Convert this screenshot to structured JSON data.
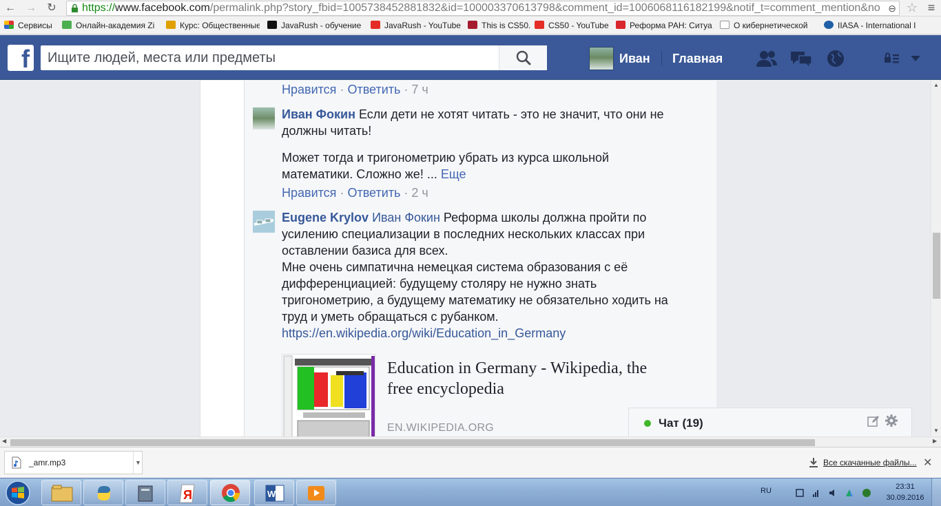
{
  "browser": {
    "url_scheme": "https://",
    "url_host": "www.facebook.com",
    "url_path": "/permalink.php?story_fbid=1005738452881832&id=100003370613798&comment_id=1006068116182199&notif_t=comment_mention&no",
    "bookmarks": [
      {
        "label": "Сервисы",
        "color": "#5c8fd6"
      },
      {
        "label": "Онлайн-академия Zi",
        "color": "#4caf50"
      },
      {
        "label": "Курс: Общественные",
        "color": "#e0a000"
      },
      {
        "label": "JavaRush - обучение",
        "color": "#111111"
      },
      {
        "label": "JavaRush - YouTube",
        "color": "#e52d27"
      },
      {
        "label": "This is CS50.",
        "color": "#a51c30"
      },
      {
        "label": "CS50 - YouTube",
        "color": "#e52d27"
      },
      {
        "label": "Реформа РАН: Ситуа",
        "color": "#d9262c"
      },
      {
        "label": "О кибернетической",
        "color": "#999999"
      },
      {
        "label": "IIASA - International I",
        "color": "#1f5fa5"
      }
    ]
  },
  "header": {
    "search_placeholder": "Ищите людей, места или предметы",
    "user_name": "Иван",
    "home_label": "Главная"
  },
  "comments": {
    "prev_actions": {
      "like": "Нравится",
      "reply": "Ответить",
      "time": "7 ч"
    },
    "c1": {
      "author": "Иван Фокин",
      "text1": "Если дети не хотят читать - это не значит, что они не должны читать!",
      "text2": "Может тогда и тригонометрию убрать из курса школьной математики. Сложно же! ...",
      "more": "Еще",
      "like": "Нравится",
      "reply": "Ответить",
      "time": "2 ч"
    },
    "c2": {
      "author": "Eugene Krylov",
      "mention": "Иван Фокин",
      "text1": "Реформа школы должна пройти по усилению специализации в последних нескольких классах при оставлении базиса для всех.",
      "text2": "Мне очень симпатична немецкая система образования с её дифференциацией: будущему столяру не нужно знать тригонометрию, а будущему математику не обязательно ходить на труд и уметь обращаться с рубанком.",
      "link": "https://en.wikipedia.org/wiki/Education_in_Germany",
      "preview_title": "Education in Germany - Wikipedia, the free encyclopedia",
      "preview_domain": "EN.WIKIPEDIA.ORG"
    }
  },
  "chat": {
    "label": "Чат (19)"
  },
  "downloads": {
    "file_name": "_amr.mp3",
    "show_all": "Все скачанные файлы..."
  },
  "taskbar": {
    "lang": "RU",
    "time": "23:31",
    "date": "30.09.2016"
  }
}
